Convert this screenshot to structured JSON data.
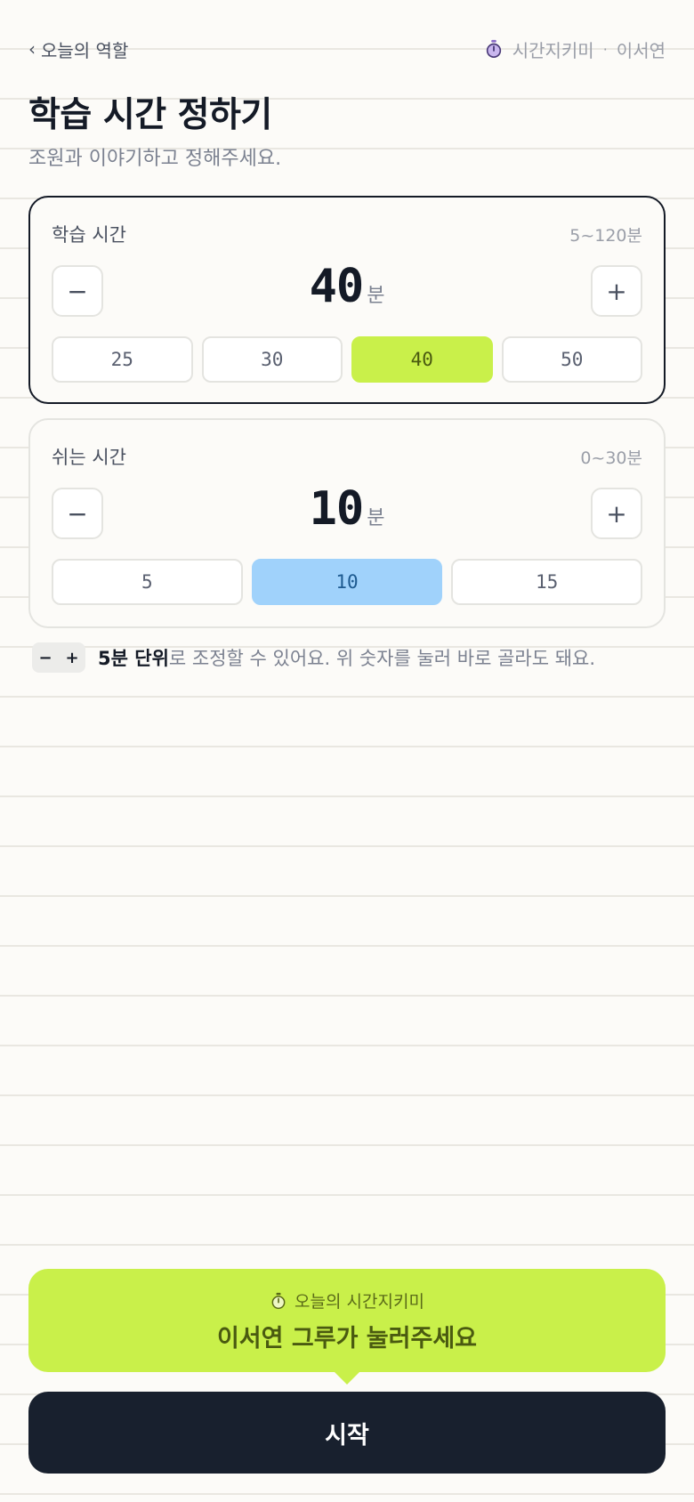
{
  "header": {
    "back_label": "오늘의 역할",
    "back_chevron": "‹",
    "role": "시간지키미",
    "separator": "·",
    "user": "이서연"
  },
  "page": {
    "title": "학습 시간 정하기",
    "subtitle": "조원과 이야기하고 정해주세요."
  },
  "study": {
    "label": "학습 시간",
    "range": "5~120분",
    "value": "40",
    "unit": "분",
    "minus": "−",
    "plus": "+",
    "presets": [
      "25",
      "30",
      "40",
      "50"
    ],
    "selected": "40",
    "accent": "#c9f04a"
  },
  "rest": {
    "label": "쉬는 시간",
    "range": "0~30분",
    "value": "10",
    "unit": "분",
    "minus": "−",
    "plus": "+",
    "presets": [
      "5",
      "10",
      "15"
    ],
    "selected": "10",
    "accent": "#a0d2fb"
  },
  "hint": {
    "chip_minus": "−",
    "chip_plus": "+",
    "bold": "5분 단위",
    "rest": "로 조정할 수 있어요. 위 숫자를 눌러 바로 골라도 돼요."
  },
  "bubble": {
    "top": "오늘의 시간지키미",
    "main": "이서연 그루가 눌러주세요"
  },
  "start_label": "시작",
  "icons": [
    "chevron-left-icon",
    "stopwatch-icon"
  ]
}
